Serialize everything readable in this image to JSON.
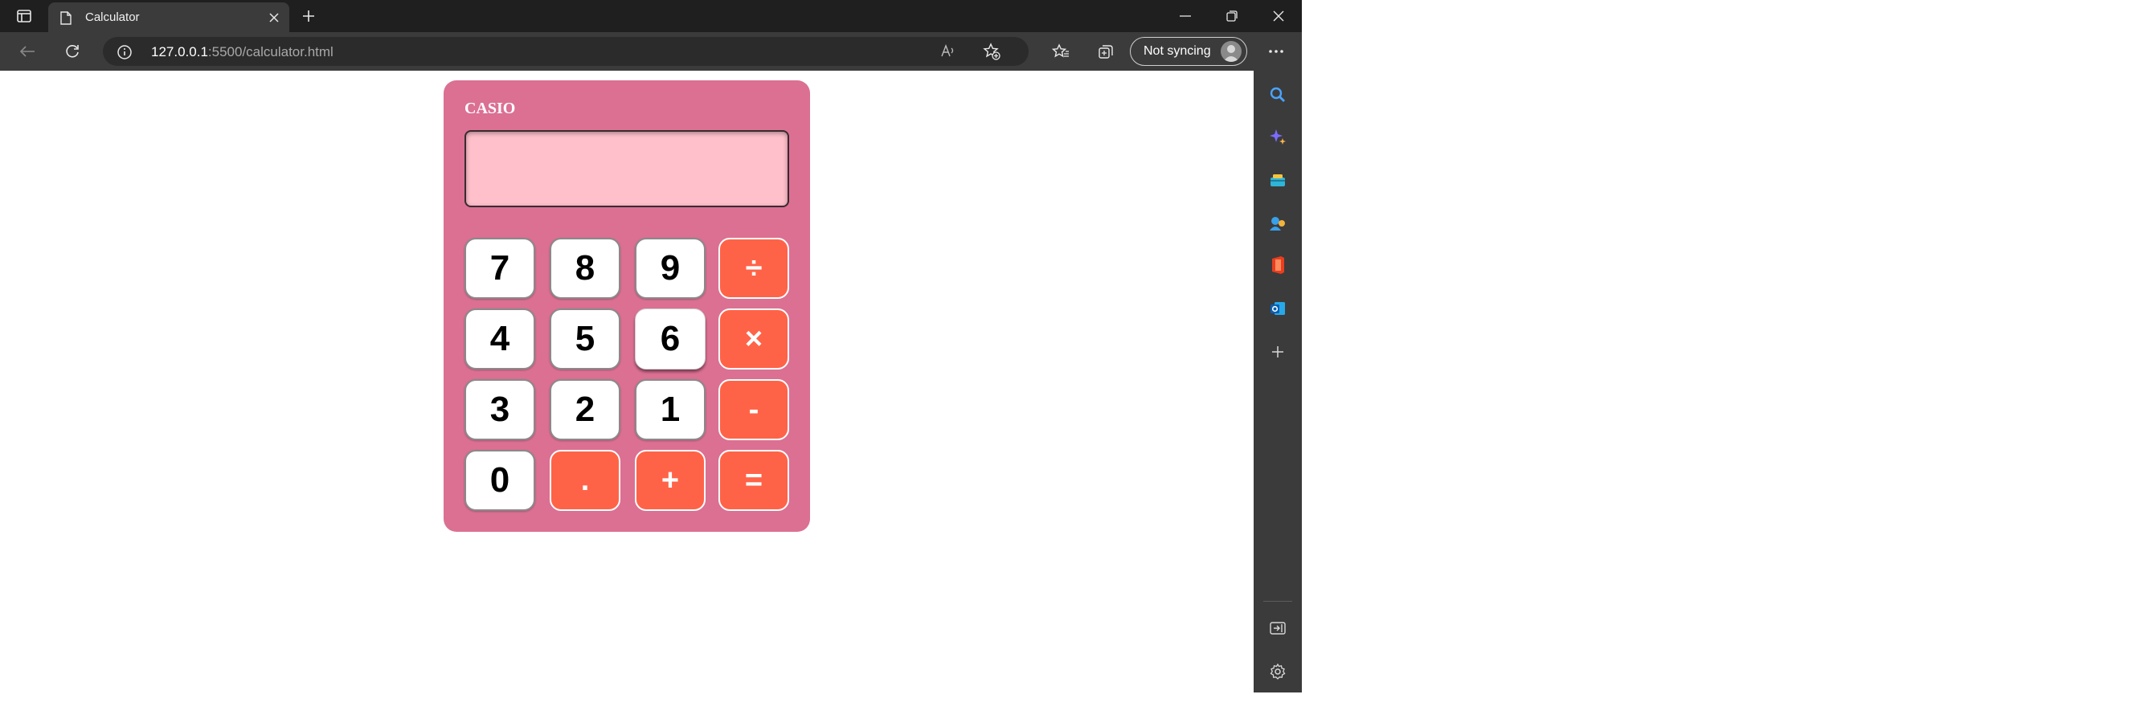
{
  "browser": {
    "tab_title": "Calculator",
    "url_host": "127.0.0.1",
    "url_rest": ":5500/calculator.html",
    "sync_label": "Not syncing",
    "icons": {
      "tab_actions": "tab-actions-icon",
      "favicon": "page-icon",
      "tab_close": "close-icon",
      "new_tab": "plus-icon",
      "back": "back-arrow-icon",
      "refresh": "refresh-icon",
      "site_info": "info-icon",
      "read_aloud": "read-aloud-icon",
      "add_favorite": "add-favorite-icon",
      "favorites": "favorites-icon",
      "collections": "collections-icon",
      "more": "ellipsis-icon"
    },
    "window_controls": [
      "minimize",
      "restore",
      "close"
    ],
    "sidebar": [
      "search",
      "copilot",
      "shopping",
      "games",
      "office",
      "outlook",
      "add",
      "hide-sidebar",
      "settings"
    ]
  },
  "calculator": {
    "brand": "CASIO",
    "display_value": "",
    "colors": {
      "body": "#db7093",
      "display": "#ffc0cb",
      "number_key": "#ffffff",
      "operator_key": "#ff6347"
    },
    "keys": [
      {
        "label": "7",
        "type": "number"
      },
      {
        "label": "8",
        "type": "number"
      },
      {
        "label": "9",
        "type": "number"
      },
      {
        "label": "÷",
        "type": "operator"
      },
      {
        "label": "4",
        "type": "number"
      },
      {
        "label": "5",
        "type": "number"
      },
      {
        "label": "6",
        "type": "number"
      },
      {
        "label": "×",
        "type": "operator"
      },
      {
        "label": "3",
        "type": "number"
      },
      {
        "label": "2",
        "type": "number"
      },
      {
        "label": "1",
        "type": "number"
      },
      {
        "label": "-",
        "type": "operator"
      },
      {
        "label": "0",
        "type": "number"
      },
      {
        "label": ".",
        "type": "operator"
      },
      {
        "label": "+",
        "type": "operator"
      },
      {
        "label": "=",
        "type": "operator"
      }
    ]
  }
}
